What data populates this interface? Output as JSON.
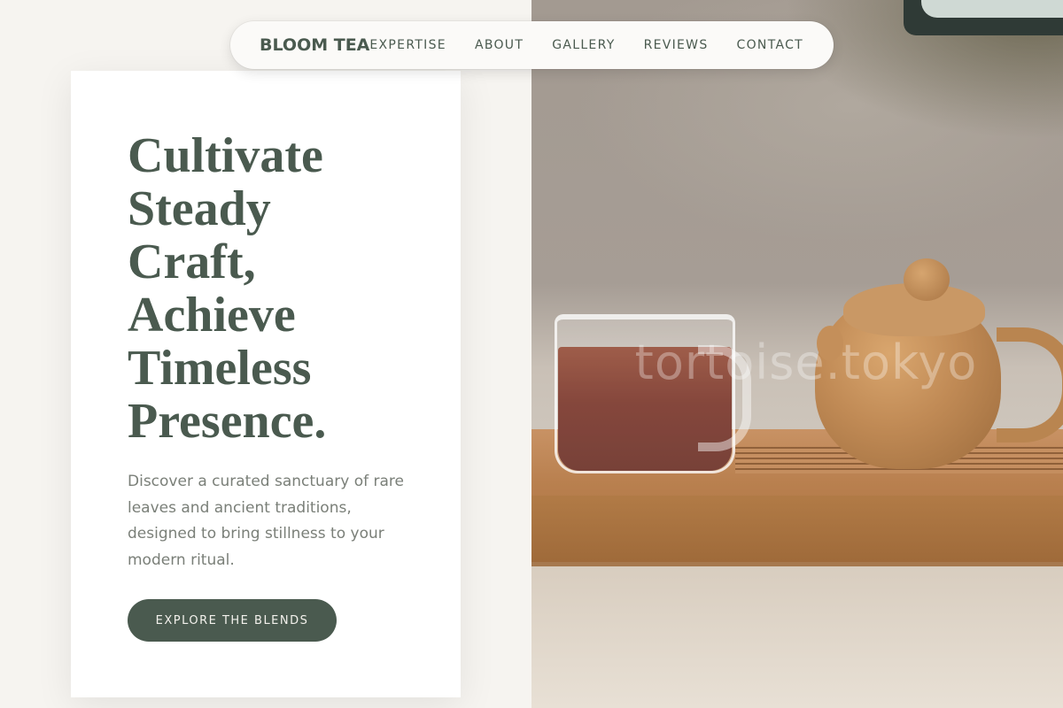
{
  "nav": {
    "brand": "BLOOM TEA",
    "links": [
      {
        "label": "EXPERTISE"
      },
      {
        "label": "ABOUT"
      },
      {
        "label": "GALLERY"
      },
      {
        "label": "REVIEWS"
      },
      {
        "label": "CONTACT"
      }
    ]
  },
  "hero": {
    "headline_lines": [
      "Cultivate",
      "Steady",
      "Craft,",
      "Achieve",
      "Timeless",
      "Presence."
    ],
    "lead": "Discover a curated sanctuary of rare leaves and ancient traditions, designed to bring stillness to your modern ritual.",
    "cta_label": "EXPLORE THE BLENDS"
  },
  "photo": {
    "watermark": "tortoise.tokyo"
  },
  "colors": {
    "accent": "#4a5a4f",
    "page_bg": "#f6f4f0",
    "card_bg": "#ffffff",
    "body_text": "#7a7f78"
  }
}
